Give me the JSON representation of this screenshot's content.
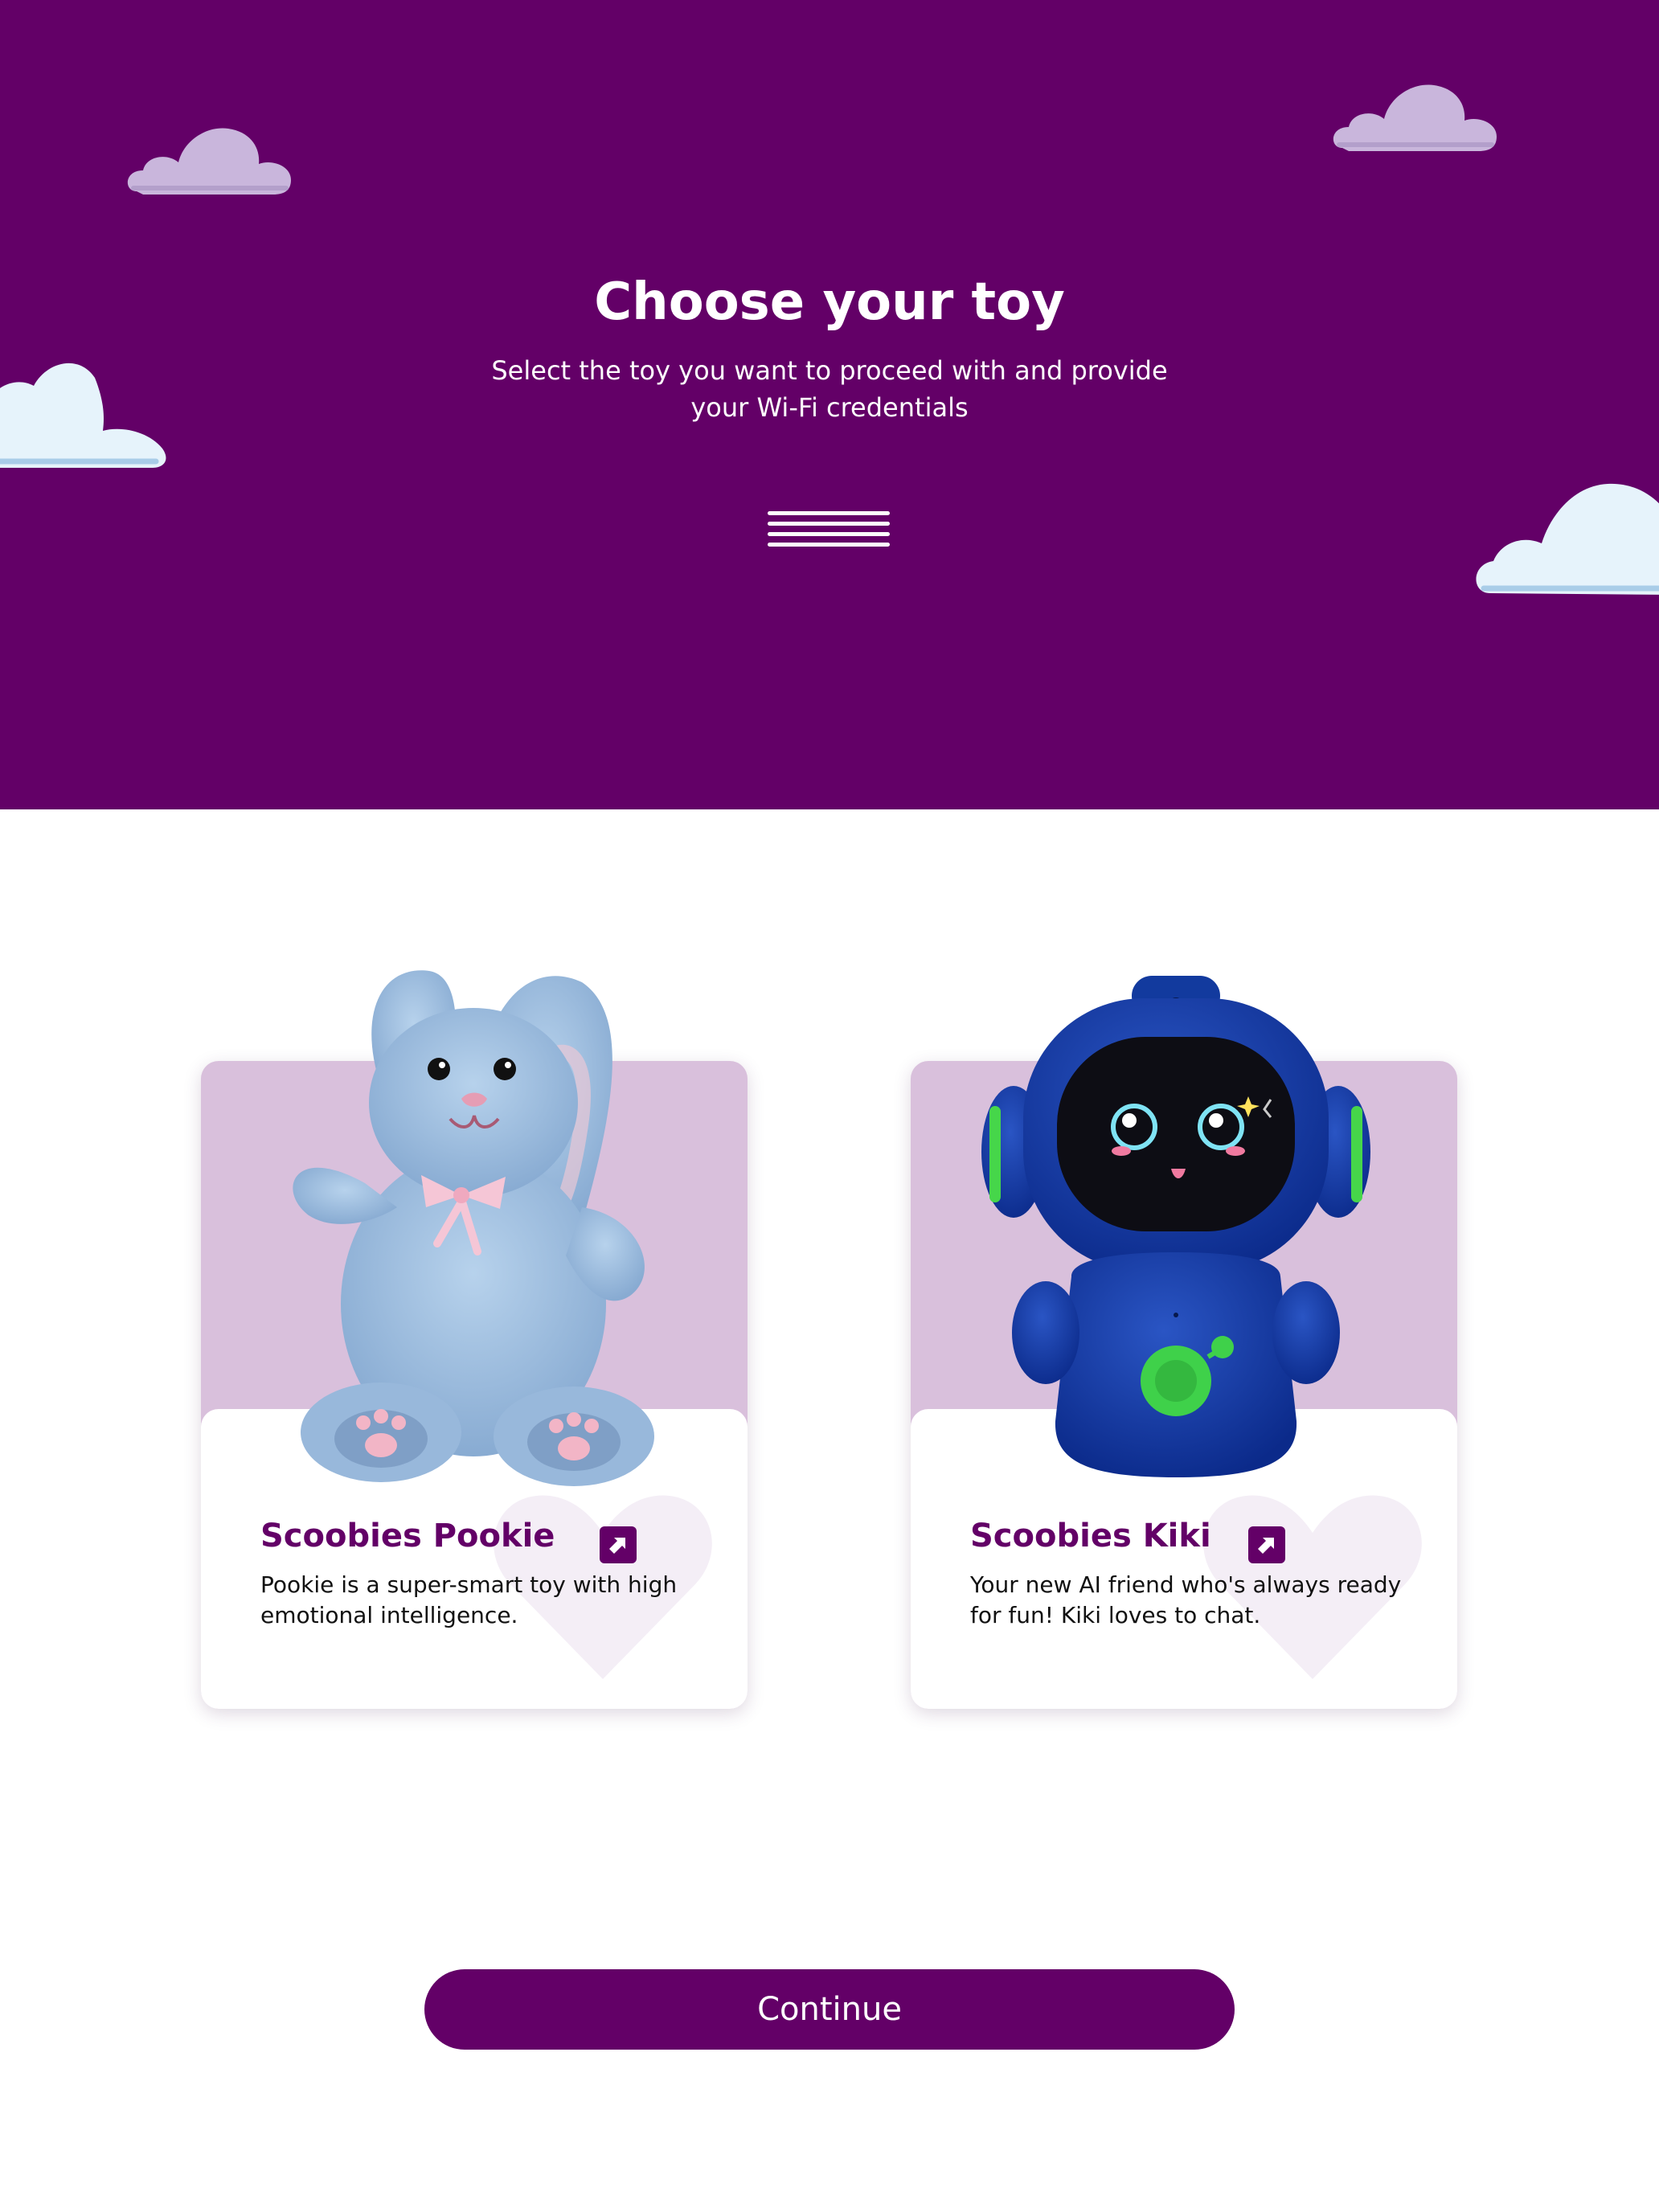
{
  "header": {
    "title": "Choose your toy",
    "subtitle": "Select the toy you want to proceed with and provide your Wi-Fi credentials"
  },
  "toys": [
    {
      "name": "Scoobies Pookie",
      "description": "Pookie is a super-smart toy with high emotional intelligence.",
      "image_icon": "bunny-plush-image",
      "selected": false
    },
    {
      "name": "Scoobies Kiki",
      "description": "Your new AI friend who's always ready for fun! Kiki loves to chat.",
      "image_icon": "robot-toy-image",
      "selected": false
    }
  ],
  "actions": {
    "continue_label": "Continue"
  },
  "colors": {
    "brand_purple": "#630067",
    "card_lilac": "#d9c0dc",
    "cloud_white": "#e6f3fb",
    "cloud_lilac": "#c9b6dc"
  }
}
